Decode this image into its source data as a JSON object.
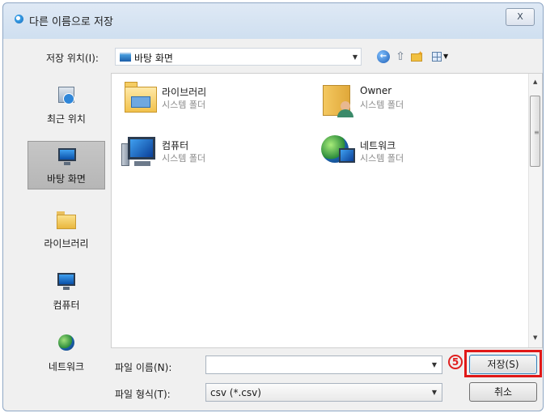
{
  "window": {
    "title": "다른 이름으로 저장",
    "close_label": "X"
  },
  "toolbar": {
    "save_in_label": "저장 위치(I):",
    "save_in_value": "바탕 화면"
  },
  "places": [
    {
      "label": "최근 위치",
      "icon": "recent-places-icon"
    },
    {
      "label": "바탕 화면",
      "icon": "desktop-icon",
      "selected": true
    },
    {
      "label": "라이브러리",
      "icon": "library-icon"
    },
    {
      "label": "컴퓨터",
      "icon": "computer-icon"
    },
    {
      "label": "네트워크",
      "icon": "network-icon"
    }
  ],
  "files": [
    {
      "name": "라이브러리",
      "type": "시스템 폴더",
      "icon": "library-folder-icon"
    },
    {
      "name": "Owner",
      "type": "시스템 폴더",
      "icon": "user-folder-icon"
    },
    {
      "name": "컴퓨터",
      "type": "시스템 폴더",
      "icon": "computer-icon"
    },
    {
      "name": "네트워크",
      "type": "시스템 폴더",
      "icon": "network-icon"
    }
  ],
  "form": {
    "filename_label": "파일 이름(N):",
    "filename_value": "",
    "filetype_label": "파일 형식(T):",
    "filetype_value": "csv (*.csv)"
  },
  "buttons": {
    "save": "저장(S)",
    "cancel": "취소"
  },
  "annotation": {
    "step": "5",
    "color": "#e01818"
  }
}
